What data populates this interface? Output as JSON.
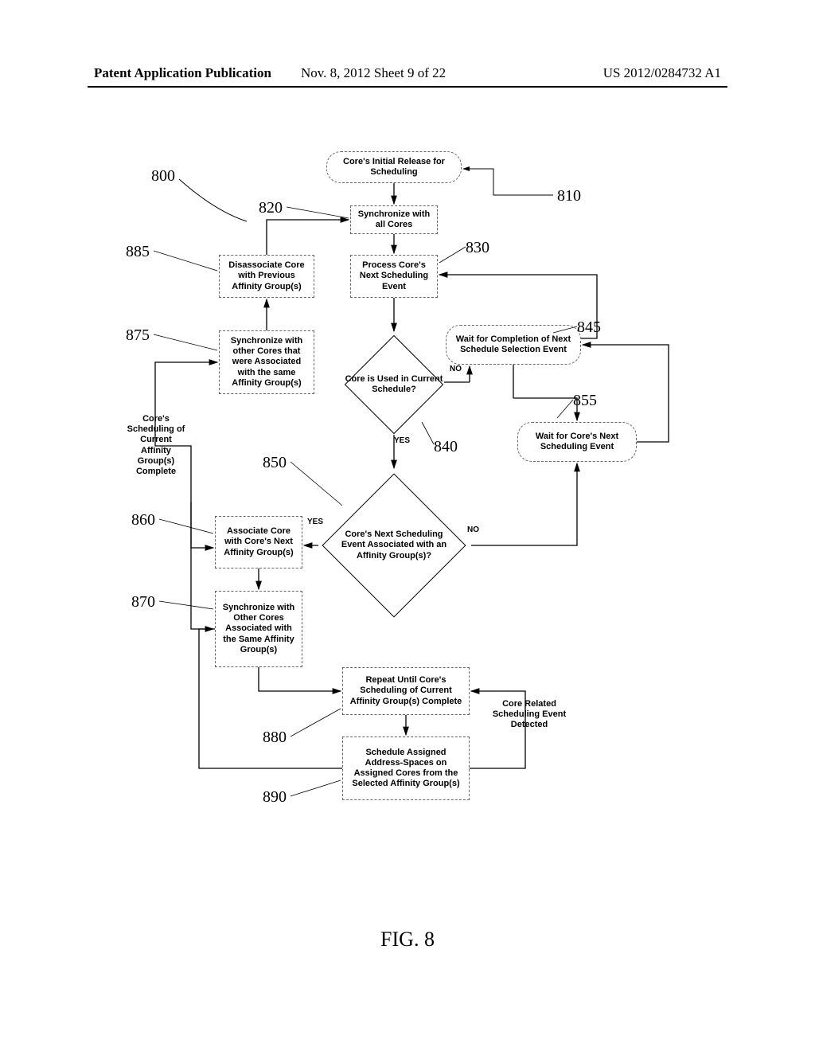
{
  "header": {
    "left": "Patent Application Publication",
    "center": "Nov. 8, 2012  Sheet 9 of 22",
    "right": "US 2012/0284732 A1"
  },
  "fig_caption": "FIG. 8",
  "refs": {
    "n800": "800",
    "n810": "810",
    "n820": "820",
    "n830": "830",
    "n840": "840",
    "n845": "845",
    "n850": "850",
    "n855": "855",
    "n860": "860",
    "n870": "870",
    "n875": "875",
    "n880": "880",
    "n885": "885",
    "n890": "890"
  },
  "boxes": {
    "b810": "Core's Initial Release for Scheduling",
    "b820": "Synchronize with all Cores",
    "b830": "Process Core's Next Scheduling Event",
    "b840": "Core is Used in Current Schedule?",
    "b845": "Wait for Completion of Next Schedule Selection Event",
    "b850": "Core's Next Scheduling Event Associated with an Affinity Group(s)?",
    "b855": "Wait for Core's Next Scheduling Event",
    "b860": "Associate Core with Core's Next Affinity Group(s)",
    "b870": "Synchronize with Other Cores Associated with the Same Affinity Group(s)",
    "b875": "Synchronize with other Cores that were Associated with the same Affinity Group(s)",
    "b880": "Repeat Until Core's Scheduling of Current Affinity Group(s) Complete",
    "b885": "Disassociate Core with Previous Affinity Group(s)",
    "b890": "Schedule Assigned Address-Spaces on Assigned Cores from the Selected Affinity Group(s)"
  },
  "labels": {
    "yes": "YES",
    "no": "NO",
    "sched_complete": "Core's Scheduling of Current Affinity Group(s) Complete",
    "event_detected": "Core Related Scheduling Event Detected"
  }
}
